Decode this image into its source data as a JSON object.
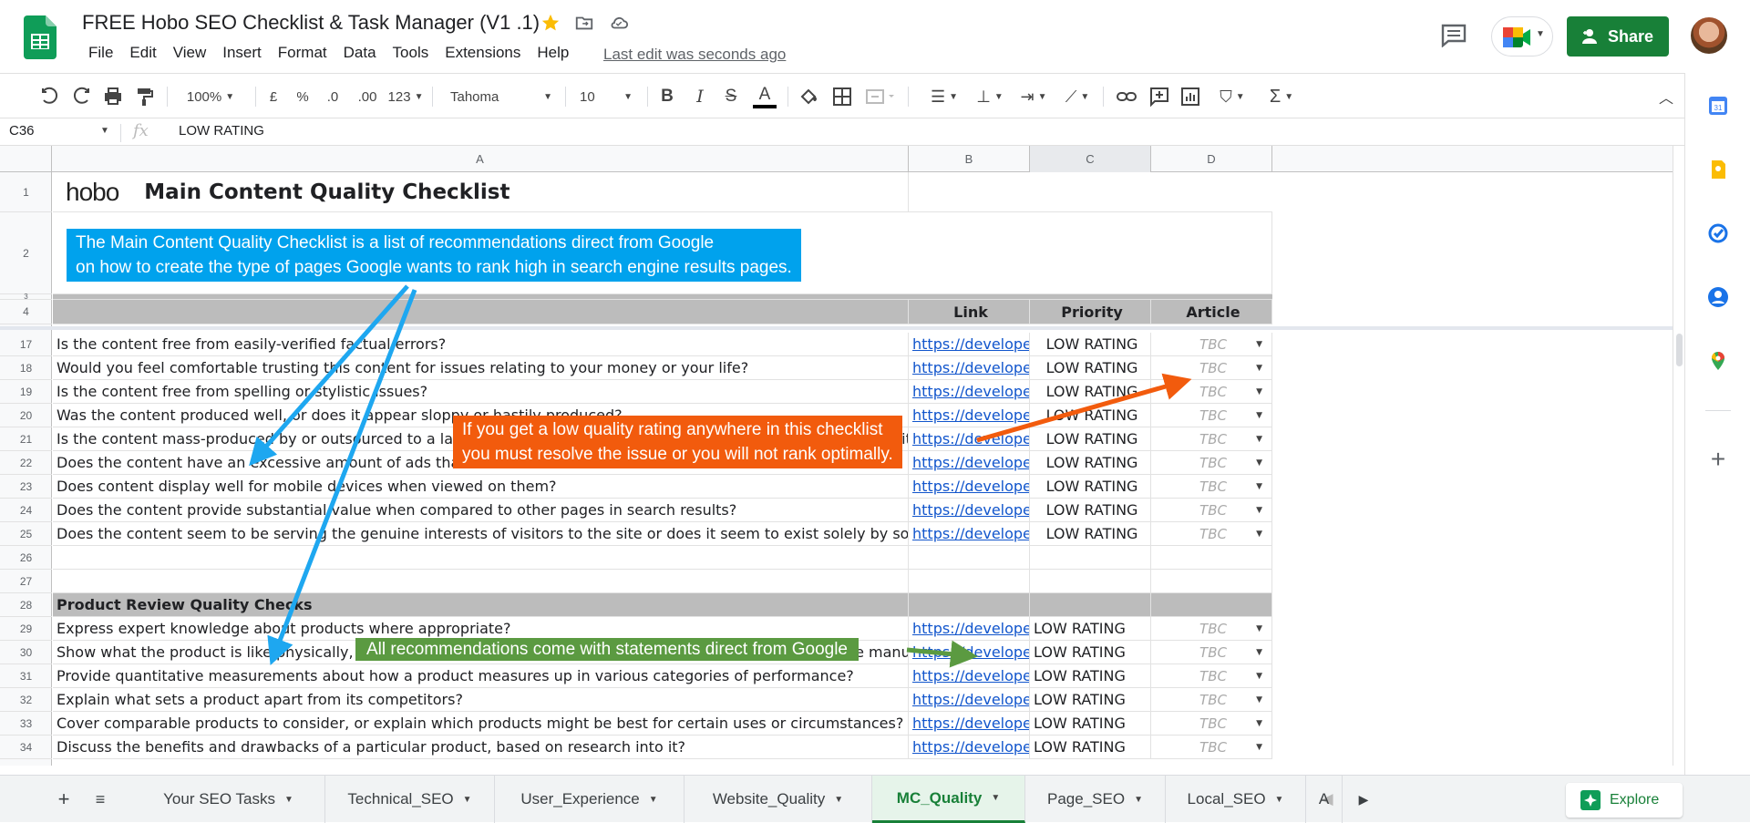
{
  "header": {
    "title": "FREE Hobo SEO Checklist & Task Manager (V1 .1)",
    "menu": [
      "File",
      "Edit",
      "View",
      "Insert",
      "Format",
      "Data",
      "Tools",
      "Extensions",
      "Help"
    ],
    "last_edit": "Last edit was seconds ago",
    "share_label": "Share",
    "accent": "#188038"
  },
  "toolbar": {
    "zoom": "100%",
    "currency": "£",
    "percent": "%",
    "dec_decrease": ".0",
    "dec_increase": ".00",
    "number_format": "123",
    "font": "Tahoma",
    "font_size": "10"
  },
  "formula_bar": {
    "cell_ref": "C36",
    "fx": "fx",
    "content": "LOW RATING"
  },
  "columns": [
    "A",
    "B",
    "C",
    "D"
  ],
  "sheet": {
    "brand": "hobo",
    "title": "Main Content Quality Checklist",
    "header_row": {
      "link": "Link",
      "priority": "Priority",
      "article": "Article"
    },
    "rows": [
      {
        "num": "17",
        "text": "Is the content free from easily-verified factual errors?",
        "link": "https://developers",
        "priority": "LOW RATING",
        "article": "TBC"
      },
      {
        "num": "18",
        "text": "Would you feel comfortable trusting this content for issues relating to your money or your life?",
        "link": "https://developers",
        "priority": "LOW RATING",
        "article": "TBC"
      },
      {
        "num": "19",
        "text": "Is the content free from spelling or stylistic issues?",
        "link": "https://developers",
        "priority": "LOW RATING",
        "article": "TBC"
      },
      {
        "num": "20",
        "text": "Was the content produced well, or does it appear sloppy or hastily produced?",
        "link": "https://developers",
        "priority": "LOW RATING",
        "article": "TBC"
      },
      {
        "num": "21",
        "text": "Is the content mass-produced by or outsourced to a large number of creators, or spread across a large network of sites?",
        "link": "https://developers",
        "priority": "LOW RATING",
        "article": "TBC"
      },
      {
        "num": "22",
        "text": "Does the content have an excessive amount of ads that distract from or interfere with the main content?",
        "link": "https://developers",
        "priority": "LOW RATING",
        "article": "TBC"
      },
      {
        "num": "23",
        "text": "Does content display well for mobile devices when viewed on them?",
        "link": "https://developers",
        "priority": "LOW RATING",
        "article": "TBC"
      },
      {
        "num": "24",
        "text": "Does the content provide substantial value when compared to other pages in search results?",
        "link": "https://developers",
        "priority": "LOW RATING",
        "article": "TBC"
      },
      {
        "num": "25",
        "text": "Does the content seem to be serving the genuine interests of visitors to the site or does it seem to exist solely by someone attempting to guess what might rank well in search engines?",
        "link": "https://developers",
        "priority": "LOW RATING",
        "article": "TBC"
      }
    ],
    "empty_rows": [
      "26",
      "27"
    ],
    "section2_num": "28",
    "section2_title": "Product Review Quality Checks",
    "rows2": [
      {
        "num": "29",
        "text": "Express expert knowledge about products where appropriate?",
        "link": "https://developers",
        "priority": "LOW RATING",
        "article": "TBC"
      },
      {
        "num": "30",
        "text": "Show what the product is like physically, or how it is used, with unique content beyond what's provided by the manufacturer?",
        "link": "https://developers",
        "priority": "LOW RATING",
        "article": "TBC"
      },
      {
        "num": "31",
        "text": "Provide quantitative measurements about how a product measures up in various categories of performance?",
        "link": "https://developers",
        "priority": "LOW RATING",
        "article": "TBC"
      },
      {
        "num": "32",
        "text": "Explain what sets a product apart from its competitors?",
        "link": "https://developers",
        "priority": "LOW RATING",
        "article": "TBC"
      },
      {
        "num": "33",
        "text": "Cover comparable products to consider, or explain which products might be best for certain uses or circumstances?",
        "link": "https://developers",
        "priority": "LOW RATING",
        "article": "TBC"
      },
      {
        "num": "34",
        "text": "Discuss the benefits and drawbacks of a particular product, based on research into it?",
        "link": "https://developers",
        "priority": "LOW RATING",
        "article": "TBC"
      }
    ]
  },
  "callouts": {
    "blue_line1": "The Main Content Quality Checklist is a list of recommendations direct from Google",
    "blue_line2": "on how to create the type of pages Google wants to rank high in search engine results pages.",
    "orange_line1": "If you get a low quality rating anywhere in this checklist",
    "orange_line2": "you must resolve the issue or you will not rank optimally.",
    "green": "All recommendations come with statements direct from Google",
    "blue_color": "#00a2ed",
    "orange_color": "#f25b0d",
    "green_color": "#5b9a41"
  },
  "tabs": [
    "Your SEO Tasks",
    "Technical_SEO",
    "User_Experience",
    "Website_Quality",
    "MC_Quality",
    "Page_SEO",
    "Local_SEO",
    "A"
  ],
  "active_tab": "MC_Quality",
  "explore_label": "Explore",
  "icons": [
    "undo-icon",
    "redo-icon",
    "print-icon",
    "paint-format-icon",
    "bold-icon",
    "italic-icon",
    "strikethrough-icon",
    "text-color-icon",
    "fill-color-icon",
    "borders-icon",
    "merge-icon",
    "align-icon",
    "valign-icon",
    "wrap-icon",
    "rotate-icon",
    "link-icon",
    "comment-icon",
    "chart-icon",
    "filter-icon",
    "functions-icon"
  ]
}
